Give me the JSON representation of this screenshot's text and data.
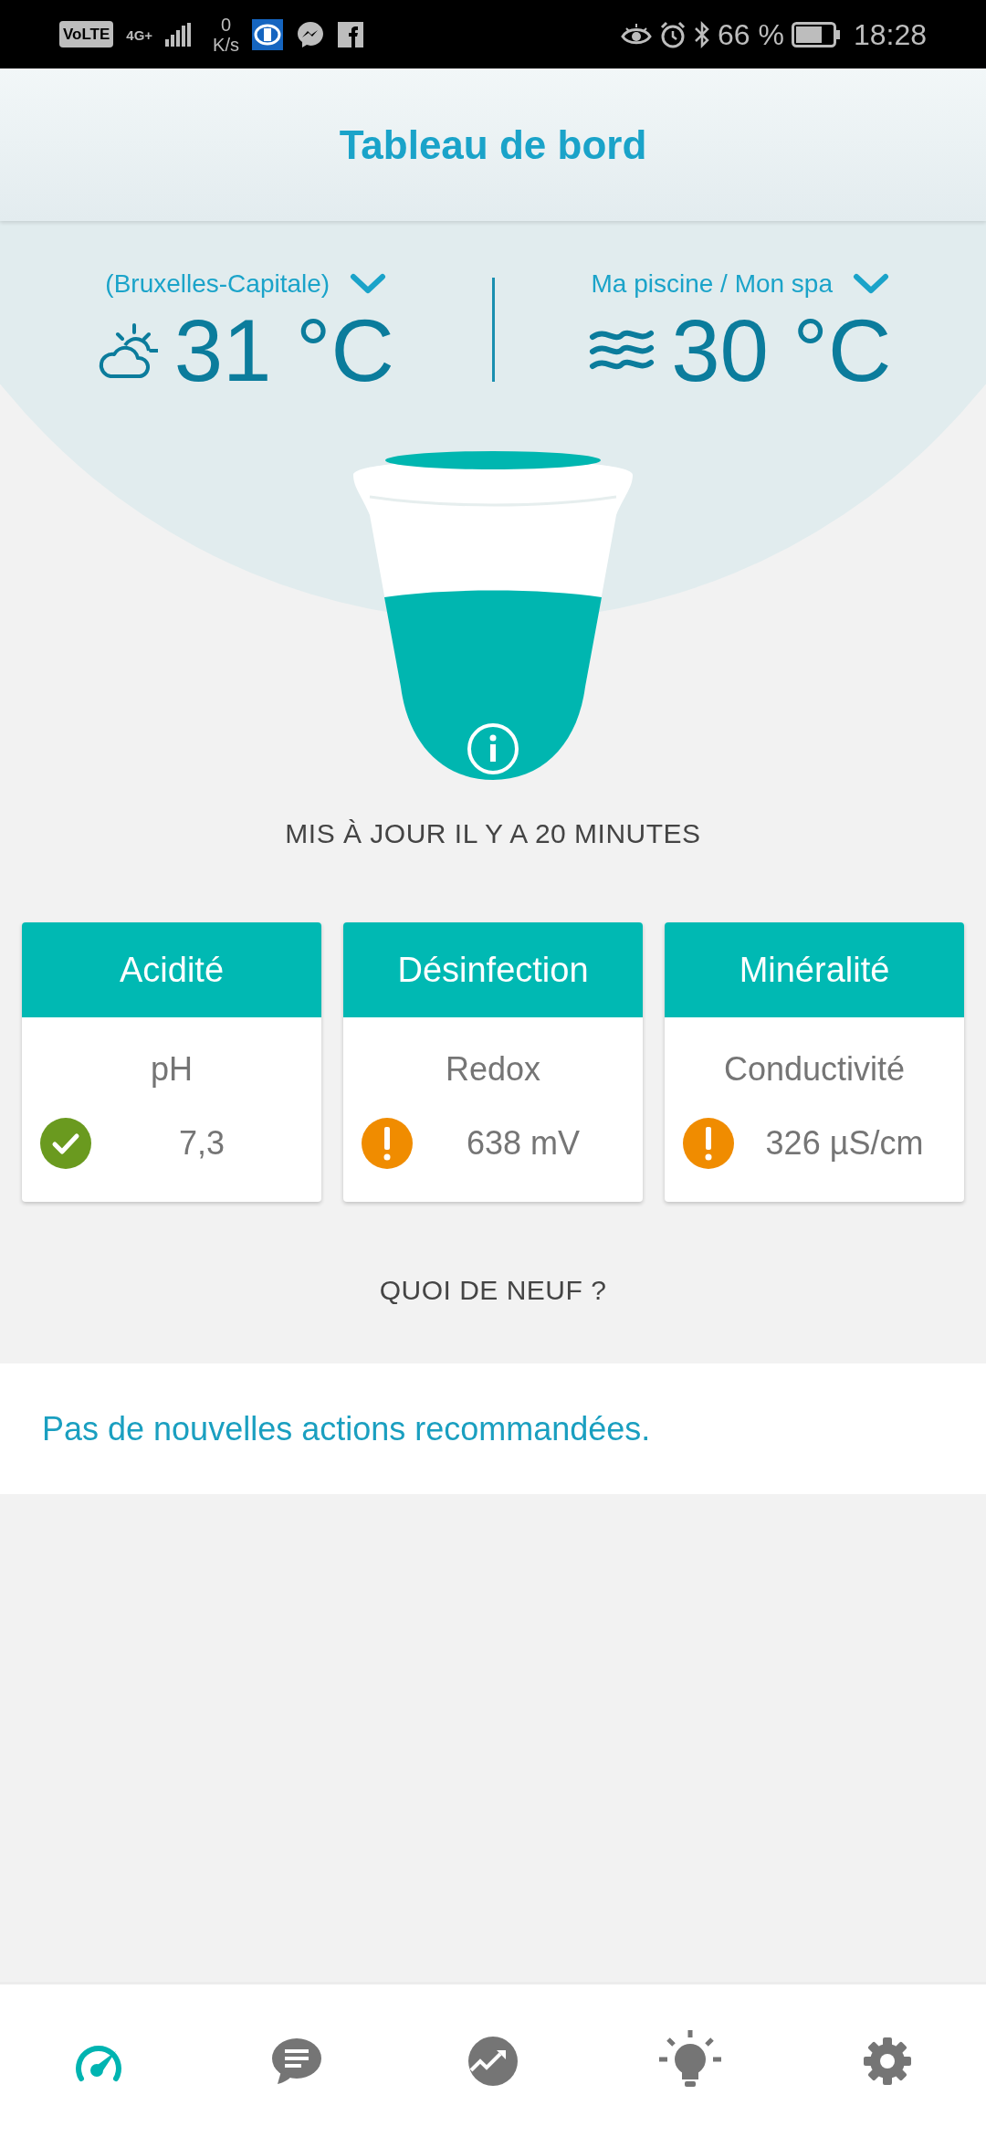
{
  "status_bar": {
    "network_badge": "VoLTE",
    "network_type": "4G+",
    "speed_value": "0",
    "speed_unit": "K/s",
    "battery": "66 %",
    "time": "18:28"
  },
  "header": {
    "title": "Tableau de bord"
  },
  "weather": {
    "location": "(Bruxelles-Capitale)",
    "temperature": "31 °C"
  },
  "pool": {
    "name": "Ma piscine / Mon spa",
    "temperature": "30 °C"
  },
  "updated": "MIS À JOUR IL Y A 20 MINUTES",
  "cards": [
    {
      "title": "Acidité",
      "label": "pH",
      "value": "7,3",
      "alert": false
    },
    {
      "title": "Désinfection",
      "label": "Redox",
      "value": "638 mV",
      "alert": true
    },
    {
      "title": "Minéralité",
      "label": "Conductivité",
      "value": "326 µS/cm",
      "alert": true
    }
  ],
  "news": {
    "heading": "QUOI DE NEUF ?",
    "message": "Pas de nouvelles actions recommandées."
  },
  "nav": [
    {
      "kind": "gauge",
      "selected": true
    },
    {
      "kind": "chat",
      "selected": false
    },
    {
      "kind": "trend",
      "selected": false
    },
    {
      "kind": "bulb",
      "selected": false
    },
    {
      "kind": "gear",
      "selected": false
    }
  ]
}
